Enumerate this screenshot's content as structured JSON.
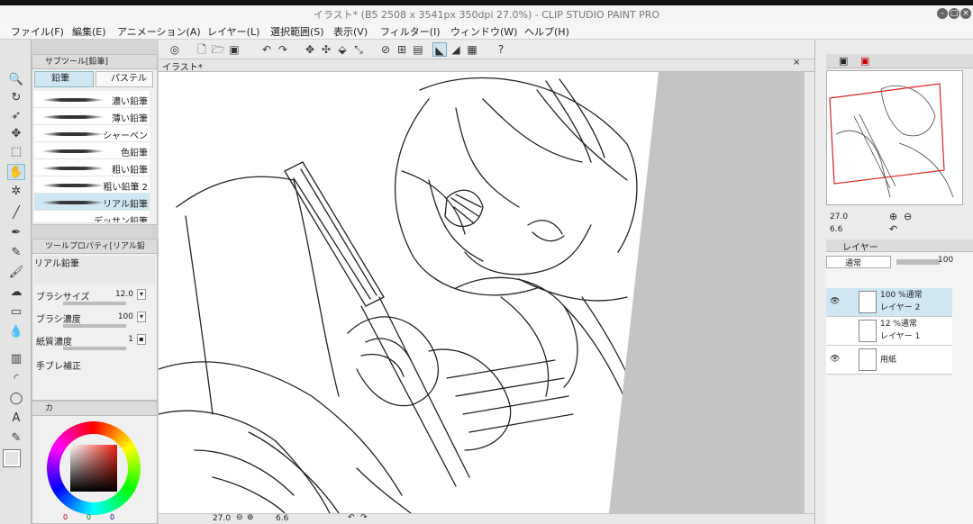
{
  "window": {
    "title": "イラスト* (B5 2508 x 3541px 350dpi 27.0%) - CLIP STUDIO PAINT PRO"
  },
  "menu": [
    "ファイル(F)",
    "編集(E)",
    "アニメーション(A)",
    "レイヤー(L)",
    "選択範囲(S)",
    "表示(V)",
    "フィルター(I)",
    "ウィンドウ(W)",
    "ヘルプ(H)"
  ],
  "subtool": {
    "title": "サブツール[鉛筆]",
    "tabs": [
      "鉛筆",
      "パステル"
    ],
    "brushes": [
      "濃い鉛筆",
      "薄い鉛筆",
      "シャーペン",
      "色鉛筆",
      "粗い鉛筆",
      "粗い鉛筆 2",
      "リアル鉛筆",
      "デッサン鉛筆"
    ],
    "selected_index": 6
  },
  "toolprop": {
    "title": "ツールプロパティ[リアル鉛",
    "preset": "リアル鉛筆",
    "rows": [
      {
        "label": "ブラシサイズ",
        "value": "12.0"
      },
      {
        "label": "ブラシ濃度",
        "value": "100"
      },
      {
        "label": "紙質濃度",
        "value": "1"
      },
      {
        "label": "手ブレ補正",
        "value": ""
      }
    ]
  },
  "color": {
    "tab": "カ",
    "r": "0",
    "g": "0",
    "b": "0",
    "main": "#000000",
    "sub": "#7fe8f0"
  },
  "canvas": {
    "tab": "イラスト*"
  },
  "status": {
    "zoom": "27.0",
    "angle": "6.6"
  },
  "navigator": {
    "zoom": "27.0",
    "angle": "6.6"
  },
  "layers": {
    "tab": "レイヤー",
    "blend_mode": "通常",
    "opacity": "100",
    "items": [
      {
        "meta": "100 %通常",
        "name": "レイヤー 2",
        "selected": true
      },
      {
        "meta": "12 %通常",
        "name": "レイヤー 1",
        "selected": false
      },
      {
        "meta": "",
        "name": "用紙",
        "selected": false
      }
    ]
  }
}
